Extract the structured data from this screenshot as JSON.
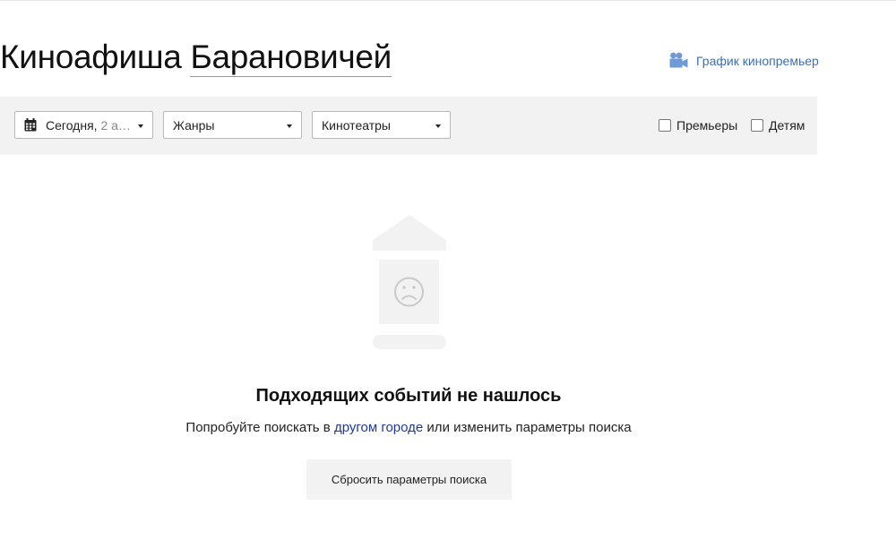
{
  "header": {
    "title_prefix": "Киноафиша",
    "city": "Барановичей",
    "schedule_link": "График кинопремьер",
    "schedule_icon": "film-camera-icon",
    "link_color": "#3f6fb0"
  },
  "filters": {
    "date_label": "Сегодня,",
    "date_value": "2 а…",
    "genres_label": "Жанры",
    "cinemas_label": "Кинотеатры",
    "premieres_label": "Премьеры",
    "premieres_checked": false,
    "kids_label": "Детям",
    "kids_checked": false,
    "bar_color": "#f2f2f2"
  },
  "empty_state": {
    "icon": "sad-billboard-icon",
    "title": "Подходящих событий не нашлось",
    "hint_before": "Попробуйте поискать в ",
    "hint_link": "другом городе",
    "hint_after": " или изменить параметры поиска",
    "reset_button": "Сбросить параметры поиска"
  }
}
